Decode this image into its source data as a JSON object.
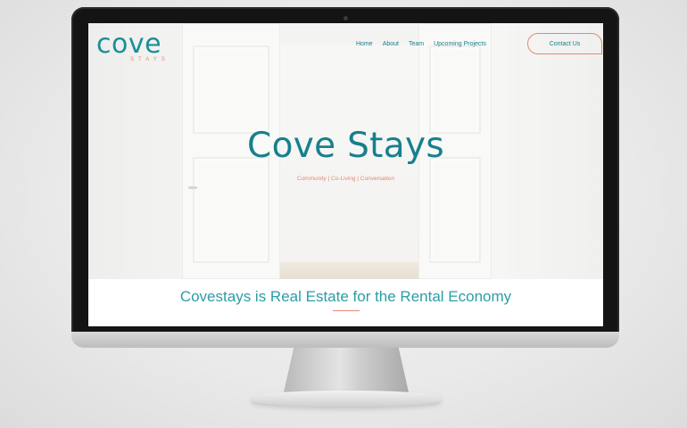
{
  "logo": {
    "word": "cove",
    "sub": "STAYS"
  },
  "nav": {
    "items": [
      "Home",
      "About",
      "Team",
      "Upcoming Projects"
    ],
    "contact_label": "Contact Us"
  },
  "hero": {
    "title": "Cove Stays",
    "subtitle": "Community | Co-Living | Conversation"
  },
  "tagline": "Covestays is Real Estate for the Rental Economy",
  "colors": {
    "teal": "#16808c",
    "coral": "#e08a73"
  }
}
